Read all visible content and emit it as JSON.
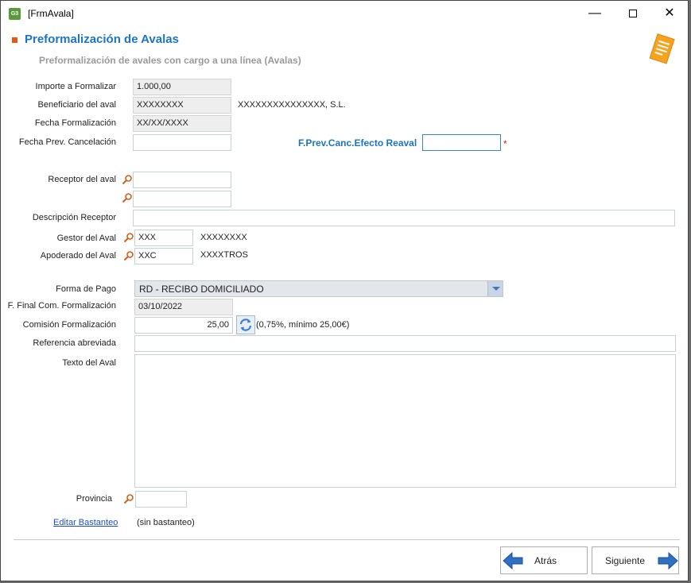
{
  "window": {
    "title": "[FrmAvala]",
    "app_icon_text": "G3",
    "minimize_label": "—",
    "close_label": "✕"
  },
  "header": {
    "title": "Preformalización de Avalas",
    "subtitle": "Preformalización de avales con cargo a una línea (Avalas)",
    "icon": "document-notes-icon"
  },
  "form": {
    "importe": {
      "label": "Importe a Formalizar",
      "value": "1.000,00"
    },
    "beneficiario": {
      "label": "Beneficiario del aval",
      "code": "XXXXXXXX",
      "name": "XXXXXXXXXXXXXXX, S.L."
    },
    "fecha_formalizacion": {
      "label": "Fecha Formalización",
      "value": "XX/XX/XXXX"
    },
    "fecha_prev_cancelacion": {
      "label": "Fecha Prev. Cancelación",
      "value": ""
    },
    "f_prev_canc_efecto": {
      "label": "F.Prev.Canc.Efecto Reaval",
      "value": "",
      "required_mark": "*"
    },
    "receptor": {
      "label": "Receptor del aval",
      "value1": "",
      "value2": ""
    },
    "descripcion_receptor": {
      "label": "Descripción Receptor",
      "value": ""
    },
    "gestor": {
      "label": "Gestor del Aval",
      "code": "XXX",
      "name": "XXXXXXXX"
    },
    "apoderado": {
      "label": "Apoderado del Aval",
      "code": "XXC",
      "name": "XXXXTROS"
    },
    "forma_pago": {
      "label": "Forma de Pago",
      "value": "RD - RECIBO DOMICILIADO"
    },
    "f_final_com": {
      "label": "F. Final Com. Formalización",
      "value": "03/10/2022"
    },
    "comision": {
      "label": "Comisión Formalización",
      "value": "25,00",
      "note": "(0,75%, mínimo 25,00€)"
    },
    "referencia": {
      "label": "Referencia abreviada",
      "value": ""
    },
    "texto_aval": {
      "label": "Texto del Aval",
      "value": ""
    },
    "provincia": {
      "label": "Provincia",
      "value": ""
    },
    "bastanteo": {
      "link": "Editar Bastanteo",
      "status": "(sin bastanteo)"
    }
  },
  "footer": {
    "back_label": "Atrás",
    "next_label": "Siguiente"
  },
  "colors": {
    "accent": "#1c74c4",
    "bullet": "#e05a12",
    "required": "#d02020",
    "arrow": "#2f6fc4"
  }
}
